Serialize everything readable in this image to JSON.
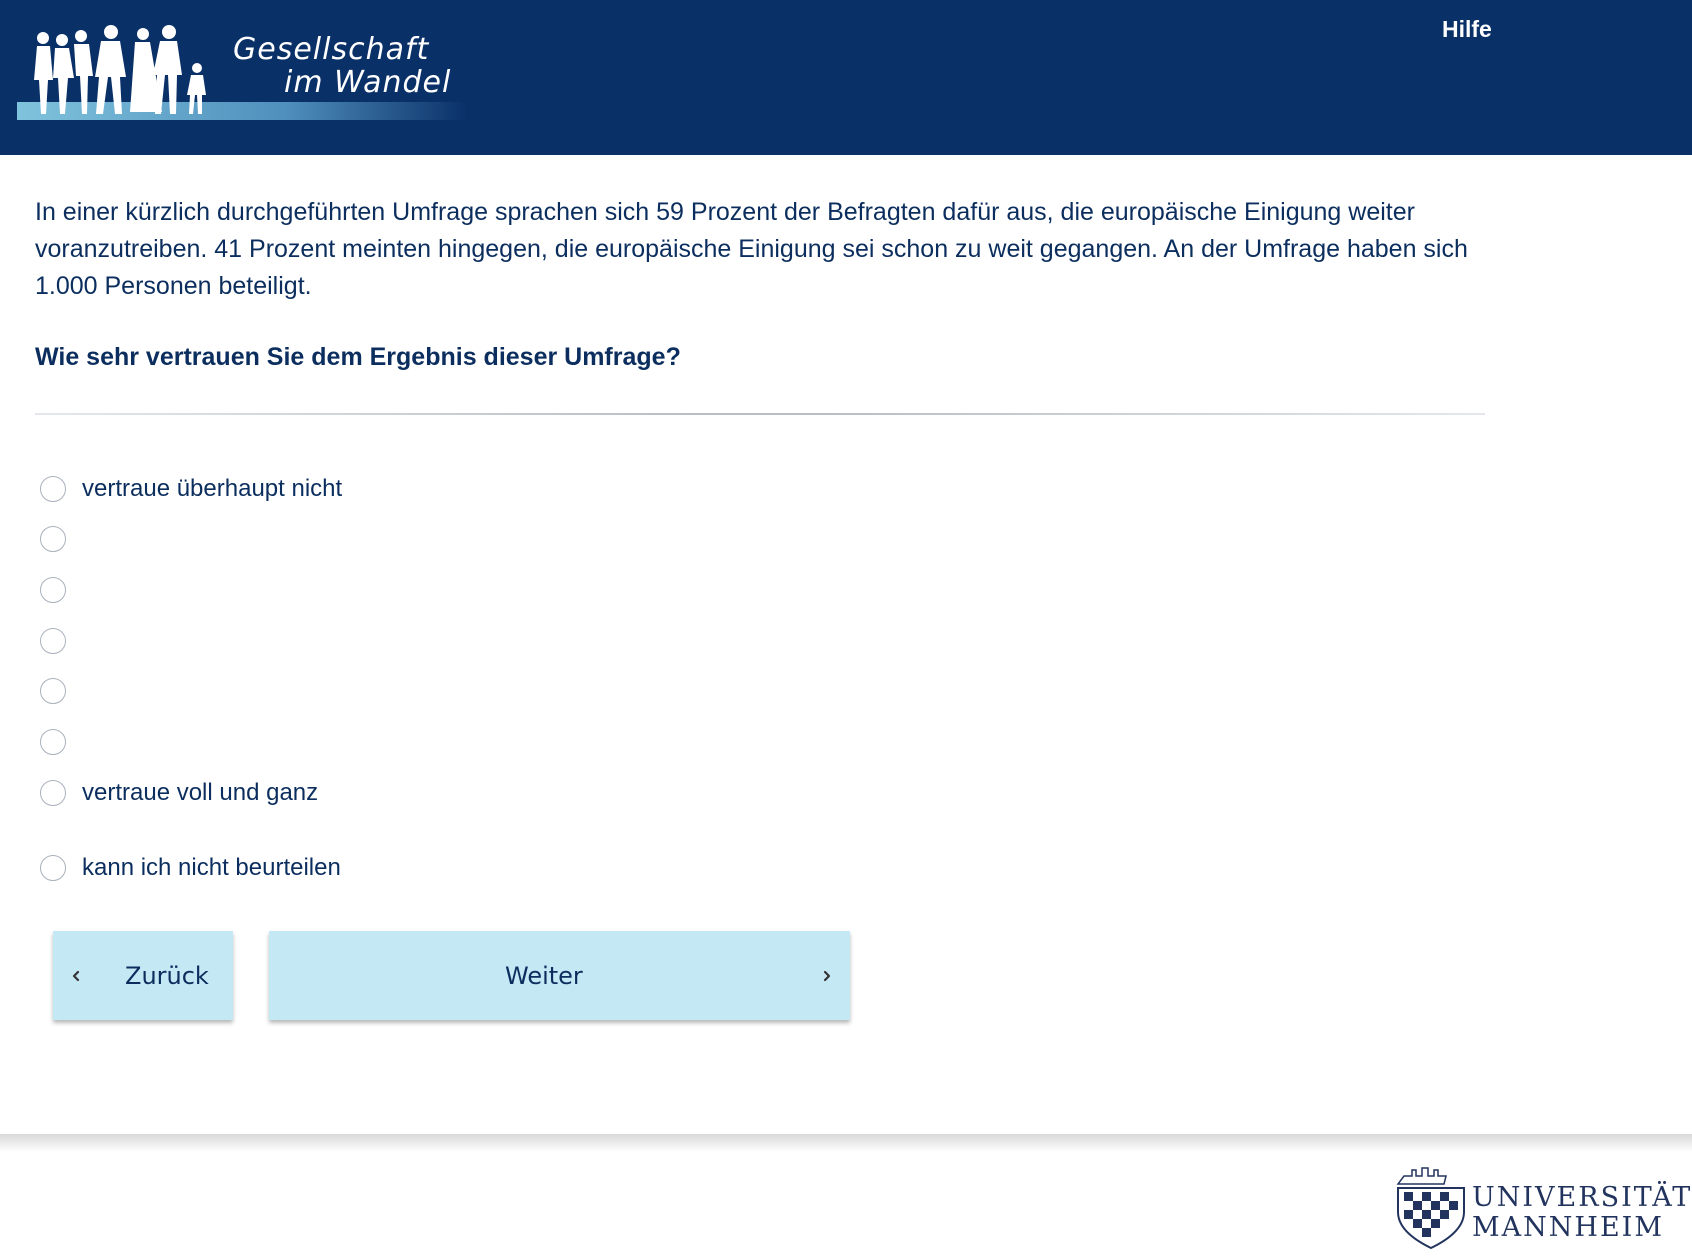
{
  "header": {
    "logo": {
      "line1": "Gesellschaft",
      "line2": "im Wandel"
    },
    "help_label": "Hilfe"
  },
  "question": {
    "intro": "In einer kürzlich durchgeführten Umfrage sprachen sich 59 Prozent der Befragten dafür aus, die europäische Einigung weiter voranzutreiben. 41 Prozent meinten hingegen, die europäische Einigung sei schon zu weit gegangen. An der Umfrage haben sich 1.000 Personen beteiligt.",
    "text": "Wie sehr vertrauen Sie dem Ergebnis dieser Umfrage?"
  },
  "options": [
    {
      "label": "vertraue überhaupt nicht",
      "selected": false
    },
    {
      "label": "",
      "selected": false
    },
    {
      "label": "",
      "selected": false
    },
    {
      "label": "",
      "selected": false
    },
    {
      "label": "",
      "selected": false
    },
    {
      "label": "",
      "selected": false
    },
    {
      "label": "vertraue voll und ganz",
      "selected": false
    },
    {
      "label": "kann ich nicht beurteilen",
      "selected": false
    }
  ],
  "navigation": {
    "back_label": "Zurück",
    "next_label": "Weiter"
  },
  "footer": {
    "university_line1": "UNIVERSITÄT",
    "university_line2": "MANNHEIM"
  },
  "colors": {
    "header_bg": "#0a3068",
    "text": "#0b2e5e",
    "button_bg": "#c5e8f5"
  }
}
